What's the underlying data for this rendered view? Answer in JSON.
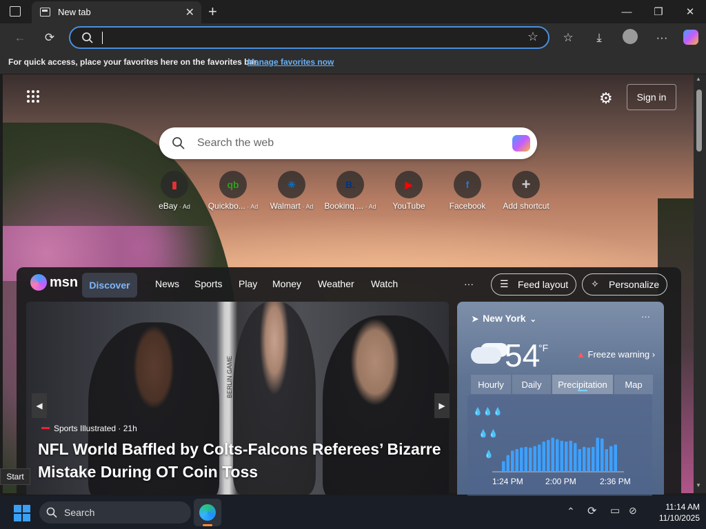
{
  "browser": {
    "tab_title": "New tab",
    "favorites_message": "For quick access, place your favorites here on the favorites bar.",
    "manage_favorites_link": "Manage favorites now",
    "address_value": ""
  },
  "newtab": {
    "sign_in": "Sign in",
    "search_placeholder": "Search the web",
    "shortcuts": [
      {
        "label": "eBay",
        "ad": "· Ad",
        "icon": "ebay-icon",
        "color": "#e53238"
      },
      {
        "label": "Quickbo...",
        "ad": "· Ad",
        "icon": "quickbooks-icon",
        "color": "#2ca01c"
      },
      {
        "label": "Walmart",
        "ad": "· Ad",
        "icon": "walmart-icon",
        "color": "#0071ce"
      },
      {
        "label": "Bookinq....",
        "ad": "· Ad",
        "icon": "booking-icon",
        "color": "#003580"
      },
      {
        "label": "YouTube",
        "ad": "",
        "icon": "youtube-icon",
        "color": "#ff0000"
      },
      {
        "label": "Facebook",
        "ad": "",
        "icon": "facebook-icon",
        "color": "#1877f2"
      },
      {
        "label": "Add shortcut",
        "ad": "",
        "icon": "plus-icon",
        "color": "#cccccc"
      }
    ]
  },
  "msn": {
    "logo": "msn",
    "nav": [
      "Discover",
      "News",
      "Sports",
      "Play",
      "Money",
      "Weather",
      "Watch"
    ],
    "more": "···",
    "feed_layout": "Feed layout",
    "personalize": "Personalize",
    "hero": {
      "source": "Sports Illustrated",
      "age": "· 21h",
      "title": "NFL World Baffled by Colts-Falcons Referees’ Bizarre Mistake During OT Coin Toss",
      "jersey_text": "BERLIN GAME"
    }
  },
  "weather": {
    "location": "New York",
    "temp": "54",
    "unit": "°F",
    "alert": "Freeze warning",
    "tabs": [
      "Hourly",
      "Daily",
      "Precipitation",
      "Map"
    ],
    "active_tab": "Precipitation",
    "precip_levels": [
      0.14,
      0.22,
      0.28,
      0.3,
      0.32,
      0.33,
      0.32,
      0.34,
      0.36,
      0.4,
      0.42,
      0.45,
      0.43,
      0.41,
      0.4,
      0.41,
      0.38,
      0.3,
      0.33,
      0.32,
      0.33,
      0.45,
      0.44,
      0.3,
      0.34,
      0.36
    ],
    "times": [
      "1:24 PM",
      "2:00 PM",
      "2:36 PM"
    ]
  },
  "taskbar": {
    "search": "Search",
    "start_tooltip": "Start",
    "time": "11:14 AM",
    "date": "11/10/2025"
  },
  "colors": {
    "accent": "#4a8fe0",
    "discover": "#7fb8ff",
    "weather_bar": "#3da0ff"
  }
}
